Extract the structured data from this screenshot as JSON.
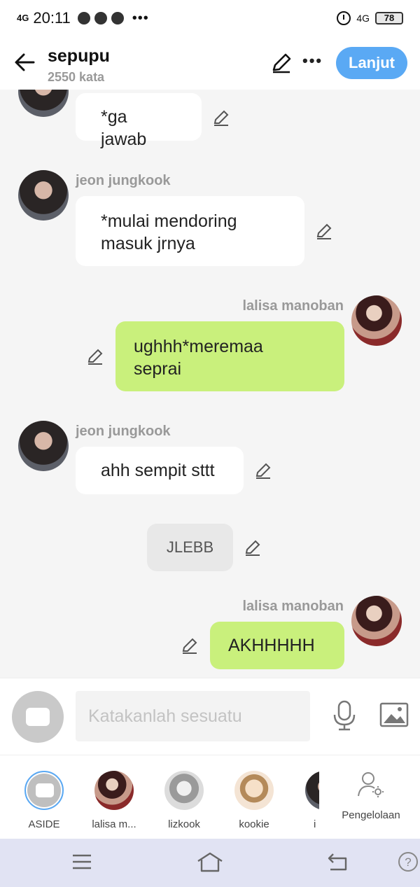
{
  "status": {
    "signal": "4G",
    "time": "20:11",
    "network": "4G",
    "battery": "78"
  },
  "header": {
    "title": "sepupu",
    "word_count": "2550 kata",
    "next_label": "Lanjut"
  },
  "messages": [
    {
      "sender": "",
      "text": "*ga jawab",
      "side": "left"
    },
    {
      "sender": "jeon jungkook",
      "text_line1": "*mulai mendoring",
      "text_line2": "masuk jrnya",
      "side": "left"
    },
    {
      "sender": "lalisa manoban",
      "text_line1": "ughhh*meremaa",
      "text_line2": "seprai",
      "side": "right"
    },
    {
      "sender": "jeon jungkook",
      "text": "ahh sempit sttt",
      "side": "left"
    },
    {
      "sender": "",
      "text": "JLEBB",
      "side": "narration"
    },
    {
      "sender": "lalisa manoban",
      "text": "AKHHHHH",
      "side": "right"
    }
  ],
  "input": {
    "placeholder": "Katakanlah sesuatu"
  },
  "characters": [
    {
      "label": "ASIDE"
    },
    {
      "label": "lalisa m..."
    },
    {
      "label": "lizkook"
    },
    {
      "label": "kookie"
    },
    {
      "label": "i"
    }
  ],
  "management_label": "Pengelolaan",
  "colors": {
    "accent": "#5aa9f4",
    "my_bubble": "#c9f07c",
    "nav": "#e1e3f3"
  }
}
